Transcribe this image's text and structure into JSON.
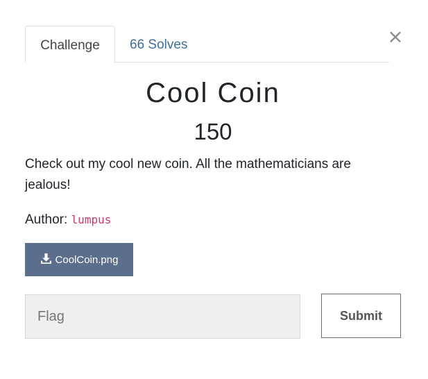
{
  "tabs": {
    "active_label": "Challenge",
    "solves_label": "66 Solves"
  },
  "close": {
    "icon": "close-icon",
    "glyph": "×"
  },
  "challenge": {
    "title": "Cool Coin",
    "points": "150",
    "description": "Check out my cool new coin. All the mathematicians are jealous!",
    "author_label": "Author:",
    "author_name": "lumpus"
  },
  "file": {
    "icon": "download-icon",
    "label": "CoolCoin.png"
  },
  "flag": {
    "placeholder": "Flag",
    "value": ""
  },
  "submit": {
    "label": "Submit"
  },
  "colors": {
    "accent": "#5b6f8d",
    "link": "#3f6fa1",
    "author": "#d6336c"
  }
}
